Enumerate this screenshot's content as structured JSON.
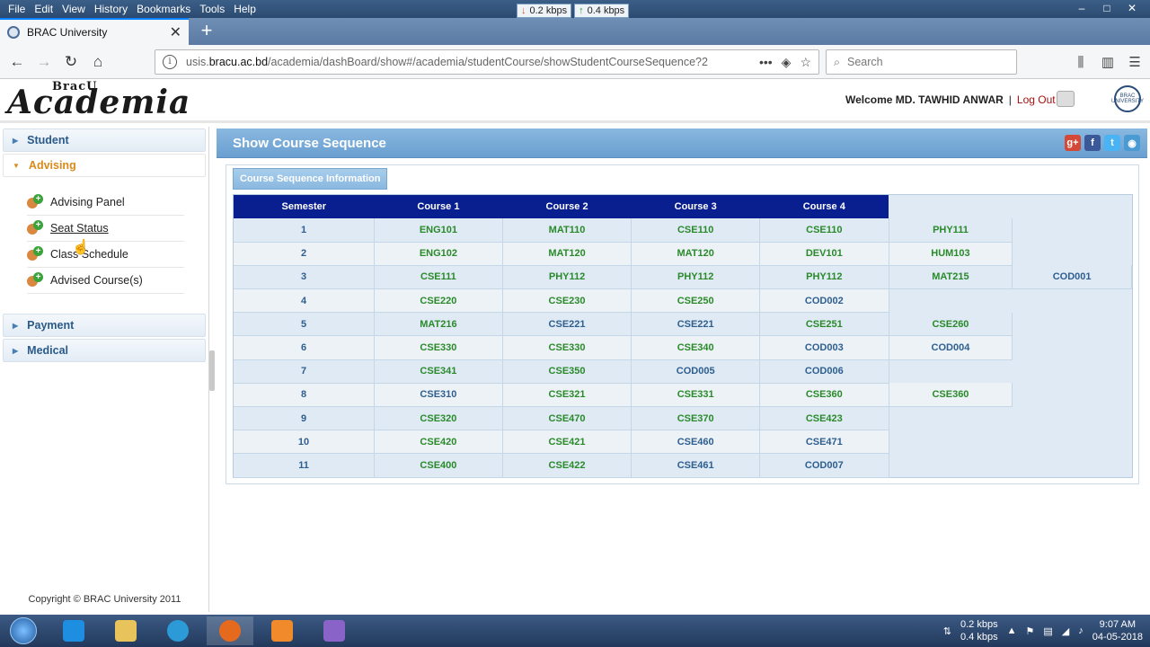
{
  "browser": {
    "menu": [
      "File",
      "Edit",
      "View",
      "History",
      "Bookmarks",
      "Tools",
      "Help"
    ],
    "net_down": "0.2 kbps",
    "net_up": "0.4 kbps",
    "tab_title": "BRAC University",
    "url_host": "usis.bracu.ac.bd",
    "url_path": "/academia/dashBoard/show#/academia/studentCourse/showStudentCourseSequence?2",
    "url_prefix": "usis.",
    "url_domain": "bracu.ac.bd",
    "search_placeholder": "Search"
  },
  "header": {
    "logo_text": "Academia",
    "logo_small": "BracU",
    "welcome": "Welcome MD. TAWHID ANWAR",
    "sep": "|",
    "logout": "Log Out",
    "seal_text": "BRAC UNIVERSITY"
  },
  "sidebar": {
    "sections": [
      {
        "label": "Student"
      },
      {
        "label": "Advising"
      },
      {
        "label": "Payment"
      },
      {
        "label": "Medical"
      }
    ],
    "advising_items": [
      "Advising Panel",
      "Seat Status",
      "Class Schedule",
      "Advised Course(s)"
    ],
    "copyright": "Copyright © BRAC University 2011"
  },
  "main": {
    "title": "Show Course Sequence",
    "info_button": "Course Sequence Information",
    "columns": [
      "Semester",
      "Course 1",
      "Course 2",
      "Course 3",
      "Course 4"
    ],
    "rows": [
      {
        "sem": "1",
        "c": [
          "ENG101",
          "MAT110",
          "CSE110",
          "CSE110"
        ],
        "extra": [
          "PHY111"
        ]
      },
      {
        "sem": "2",
        "c": [
          "ENG102",
          "MAT120",
          "MAT120",
          "DEV101"
        ],
        "extra": [
          "HUM103"
        ]
      },
      {
        "sem": "3",
        "c": [
          "CSE111",
          "PHY112",
          "PHY112",
          "PHY112"
        ],
        "extra": [
          "MAT215",
          "COD001"
        ]
      },
      {
        "sem": "4",
        "c": [
          "CSE220",
          "CSE230",
          "CSE250",
          "COD002"
        ],
        "extra": []
      },
      {
        "sem": "5",
        "c": [
          "MAT216",
          "CSE221",
          "CSE221",
          "CSE251"
        ],
        "extra": [
          "CSE260"
        ]
      },
      {
        "sem": "6",
        "c": [
          "CSE330",
          "CSE330",
          "CSE340",
          "COD003"
        ],
        "extra": [
          "COD004"
        ]
      },
      {
        "sem": "7",
        "c": [
          "CSE341",
          "CSE350",
          "COD005",
          "COD006"
        ],
        "extra": []
      },
      {
        "sem": "8",
        "c": [
          "CSE310",
          "CSE321",
          "CSE331",
          "CSE360"
        ],
        "extra": [
          "CSE360"
        ]
      },
      {
        "sem": "9",
        "c": [
          "CSE320",
          "CSE470",
          "CSE370",
          "CSE423"
        ],
        "extra": []
      },
      {
        "sem": "10",
        "c": [
          "CSE420",
          "CSE421",
          "CSE460",
          "CSE471"
        ],
        "extra": []
      },
      {
        "sem": "11",
        "c": [
          "CSE400",
          "CSE422",
          "CSE461",
          "COD007"
        ],
        "extra": []
      }
    ]
  },
  "taskbar": {
    "tray_down": "0.2 kbps",
    "tray_up": "0.4 kbps",
    "time": "9:07 AM",
    "date": "04-05-2018"
  },
  "colors": {
    "header_blue": "#0a1f8f",
    "course_green": "#2a8a2a",
    "course_blue": "#2e5f8f",
    "active_orange": "#d88a1a",
    "logout_red": "#a81010"
  }
}
